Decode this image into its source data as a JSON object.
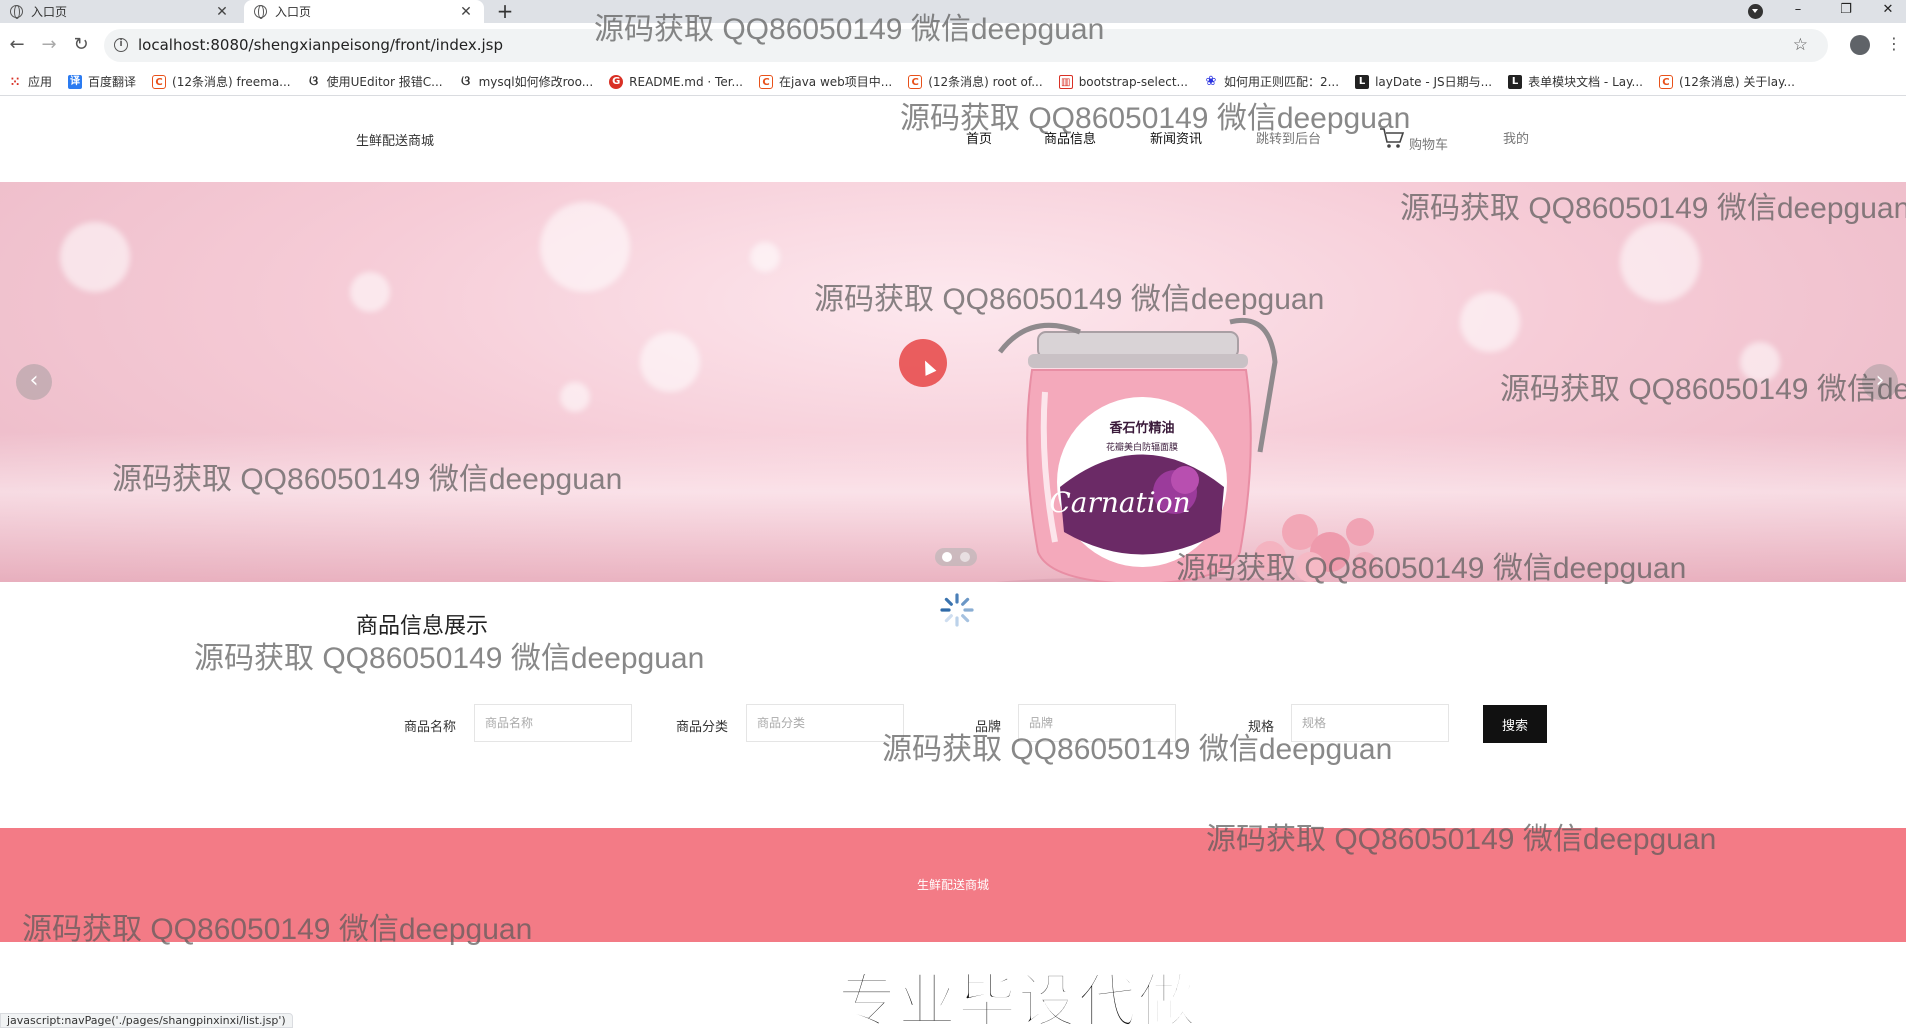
{
  "browser": {
    "tabs": [
      {
        "label": "入口页",
        "active": false
      },
      {
        "label": "入口页",
        "active": true
      }
    ],
    "new_tab_label": "+",
    "url": "localhost:8080/shengxianpeisong/front/index.jsp",
    "window_controls": {
      "minimize": "–",
      "restore": "❐",
      "close": "✕"
    },
    "bookmarks": [
      {
        "icon": "apps-icon",
        "label": "应用"
      },
      {
        "icon": "translate-icon",
        "label": "百度翻译"
      },
      {
        "icon": "csdn-icon",
        "label": "(12条消息) freema..."
      },
      {
        "icon": "github-icon",
        "label": "使用UEditor 报错C..."
      },
      {
        "icon": "github-icon",
        "label": "mysql如何修改roo..."
      },
      {
        "icon": "gitee-icon",
        "label": "README.md · Ter..."
      },
      {
        "icon": "csdn-icon",
        "label": "在java web项目中..."
      },
      {
        "icon": "csdn-icon",
        "label": "(12条消息) root of..."
      },
      {
        "icon": "bootstrap-icon",
        "label": "bootstrap-select..."
      },
      {
        "icon": "baidu-icon",
        "label": "如何用正则匹配：2..."
      },
      {
        "icon": "layui-icon",
        "label": "layDate - JS日期与..."
      },
      {
        "icon": "layui-icon",
        "label": "表单模块文档 - Lay..."
      },
      {
        "icon": "csdn-icon",
        "label": "(12条消息) 关于lay..."
      }
    ],
    "status_url": "javascript:navPage('./pages/shangpinxinxi/list.jsp')"
  },
  "site": {
    "logo": "生鲜配送商城",
    "nav": {
      "home": "首页",
      "products": "商品信息",
      "news": "新闻资讯",
      "admin": "跳转到后台",
      "cart": "购物车",
      "mine": "我的"
    },
    "section_title": "商品信息展示",
    "search": {
      "name_label": "商品名称",
      "name_placeholder": "商品名称",
      "category_label": "商品分类",
      "category_placeholder": "商品分类",
      "brand_label": "品牌",
      "brand_placeholder": "品牌",
      "spec_label": "规格",
      "spec_placeholder": "规格",
      "button": "搜索"
    },
    "footer": "生鲜配送商城"
  },
  "banner": {
    "product_label_line1": "香石竹精油",
    "product_label_line2": "花瓣美白防辐面膜",
    "product_brand": "Carnation",
    "slides_total": 2,
    "active_slide": 1,
    "prev": "‹",
    "next": "›"
  },
  "overlay": {
    "watermark": "源码获取 QQ86050149 微信deepguan",
    "promo": "专业毕设代做"
  },
  "colors": {
    "footer_bg": "#f37b86",
    "search_button_bg": "#111111",
    "banner_pink": "#f6ccd7"
  }
}
